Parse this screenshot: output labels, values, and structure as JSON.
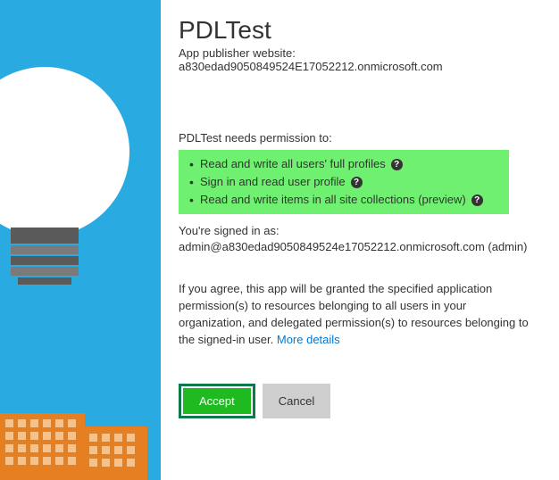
{
  "app": {
    "title": "PDLTest",
    "publisher_label": "App publisher website:",
    "publisher_value": "a830edad9050849524E17052212.onmicrosoft.com"
  },
  "permissions": {
    "heading": "PDLTest needs permission to:",
    "items": [
      "Read and write all users' full profiles",
      "Sign in and read user profile",
      "Read and write items in all site collections (preview)"
    ]
  },
  "signed_in": {
    "label": "You're signed in as:",
    "value": "admin@a830edad9050849524e17052212.onmicrosoft.com (admin)"
  },
  "agreement": {
    "text": "If you agree, this app will be granted the specified application permission(s) to resources belonging to all users in your organization, and delegated permission(s) to resources belonging to the signed-in user. ",
    "link": "More details"
  },
  "buttons": {
    "accept": "Accept",
    "cancel": "Cancel"
  }
}
